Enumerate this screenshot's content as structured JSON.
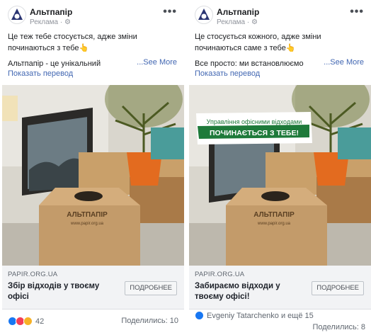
{
  "ads": [
    {
      "page_name": "Альтпапір",
      "sponsored": "Реклама · ⚙",
      "text_line1": "Це теж тебе стосується, адже зміни починаються з тебе👆",
      "text_line2": "Альтпапір - це унікальний",
      "see_more": "...See More",
      "translate": "Показать перевод",
      "image_banner": null,
      "link_domain": "PAPIR.ORG.UA",
      "link_title": "Збір відходів у твоєму офісі",
      "cta_label": "ПОДРОБНЕЕ",
      "reaction_icons": [
        "like-icon",
        "love-icon",
        "wow-icon"
      ],
      "reactions_count": "42",
      "shares": "Поделились: 10"
    },
    {
      "page_name": "Альтпапір",
      "sponsored": "Реклама · ⚙",
      "text_line1": "Це стосується кожного, адже зміни починаються саме з тебе👆",
      "text_line2": "Все просто: ми встановлюємо",
      "see_more": "...See More",
      "translate": "Показать перевод",
      "image_banner": {
        "line1": "Управління офісними відходами",
        "line2": "ПОЧИНАЄТЬСЯ З ТЕБЕ!"
      },
      "link_domain": "PAPIR.ORG.UA",
      "link_title": "Забираємо відходи у твоєму офісі!",
      "cta_label": "ПОДРОБНЕЕ",
      "reaction_icons": [
        "like-icon"
      ],
      "reactions_count": "Evgeniy Tatarchenko и ещё 15",
      "shares": "Поделились: 8"
    }
  ],
  "box_print": {
    "brand": "АЛЬТПАПІР",
    "url": "www.papir.org.ua"
  },
  "colors": {
    "link_blue": "#4267b2",
    "brand_navy": "#2a3472",
    "banner_green": "#1e7a3a",
    "like_blue": "#1877f2"
  }
}
